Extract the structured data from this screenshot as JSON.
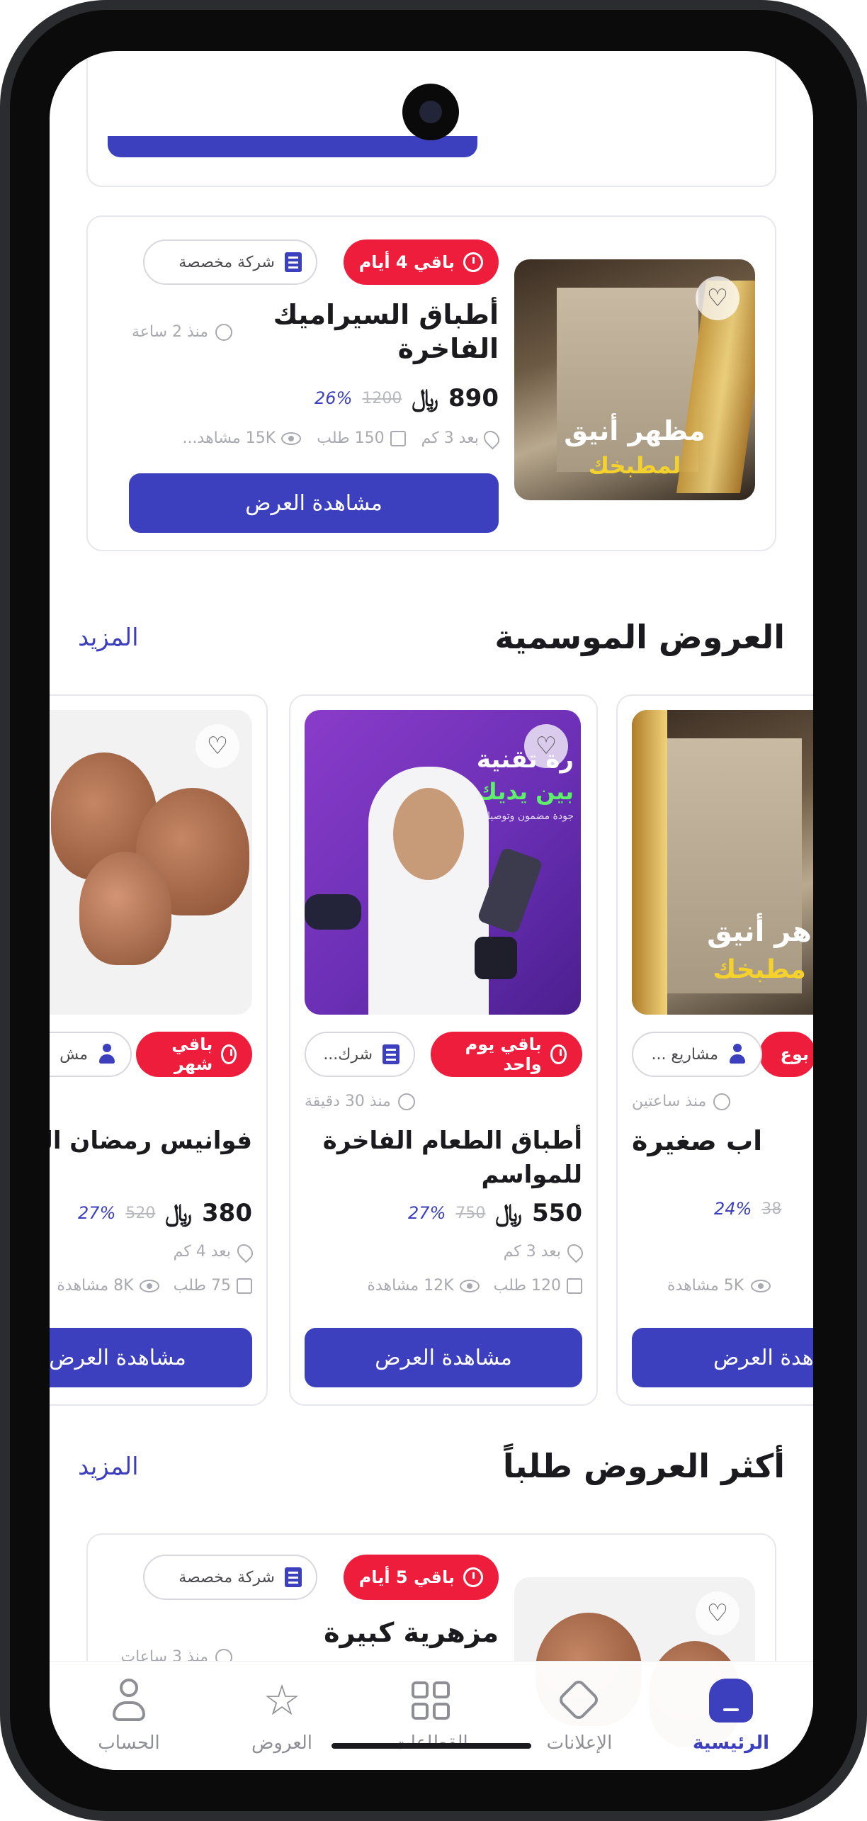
{
  "top_card": {
    "badge_time": "باقي 4 أيام",
    "badge_company": "شركة مخصصة",
    "title": "أطباق السيراميك الفاخرة",
    "ago": "منذ 2 ساعة",
    "price": "890",
    "old_price": "1200",
    "discount": "26%",
    "distance": "بعد 3 كم",
    "requests": "150 طلب",
    "views": "15K مشاهد...",
    "cta": "مشاهدة العرض",
    "image_text_line1": "مظهر أنيق",
    "image_text_line2": "لمطبخك"
  },
  "seasonal": {
    "title": "العروض الموسمية",
    "more": "المزيد",
    "cards": [
      {
        "badge_time": "بوع",
        "badge_company": "مشاريع ...",
        "ago": "منذ ساعتين",
        "title": "اب صغيرة",
        "price": "",
        "old_price": "38",
        "discount": "24%",
        "distance": "",
        "requests": "",
        "views": "5K مشاهدة",
        "cta": "اهدة العرض",
        "img_text_1": "هر أنيق",
        "img_text_2": "مطبخك"
      },
      {
        "badge_time": "باقي يوم واحد",
        "badge_company": "شرك...",
        "ago": "منذ 30 دقيقة",
        "title": "أطباق الطعام الفاخرة للمواسم",
        "price": "550",
        "old_price": "750",
        "discount": "27%",
        "distance": "بعد 3 كم",
        "requests": "120 طلب",
        "views": "12K مشاهدة",
        "cta": "مشاهدة العرض",
        "img_text_1": "رة تقنية",
        "img_text_2": "بين يديك",
        "img_text_3": "جودة مضمون وتوصيل"
      },
      {
        "badge_time": "باقي شهر",
        "badge_company": "مش",
        "ago": "",
        "title": "فوانيس رمضان الم",
        "price": "380",
        "old_price": "520",
        "discount": "27%",
        "distance": "بعد 4 كم",
        "requests": "75 طلب",
        "views": "8K مشاهدة",
        "cta": "مشاهدة العرض"
      }
    ]
  },
  "popular": {
    "title": "أكثر العروض طلباً",
    "more": "المزيد",
    "card": {
      "badge_time": "باقي 5 أيام",
      "badge_company": "شركة مخصصة",
      "title": "مزهرية كبيرة",
      "ago": "منذ 3 ساعات"
    }
  },
  "tabs": [
    {
      "label": "الرئيسية",
      "icon": "home-icon",
      "active": true
    },
    {
      "label": "الإعلانات",
      "icon": "tag-icon",
      "active": false
    },
    {
      "label": "القطاعات",
      "icon": "grid-icon",
      "active": false
    },
    {
      "label": "العروض",
      "icon": "star-badge-icon",
      "active": false
    },
    {
      "label": "الحساب",
      "icon": "user-icon",
      "active": false
    }
  ],
  "colors": {
    "accent": "#3c40bf",
    "badge": "#ee1d3b",
    "text": "#1b1b1f",
    "muted": "#a9aab1"
  }
}
